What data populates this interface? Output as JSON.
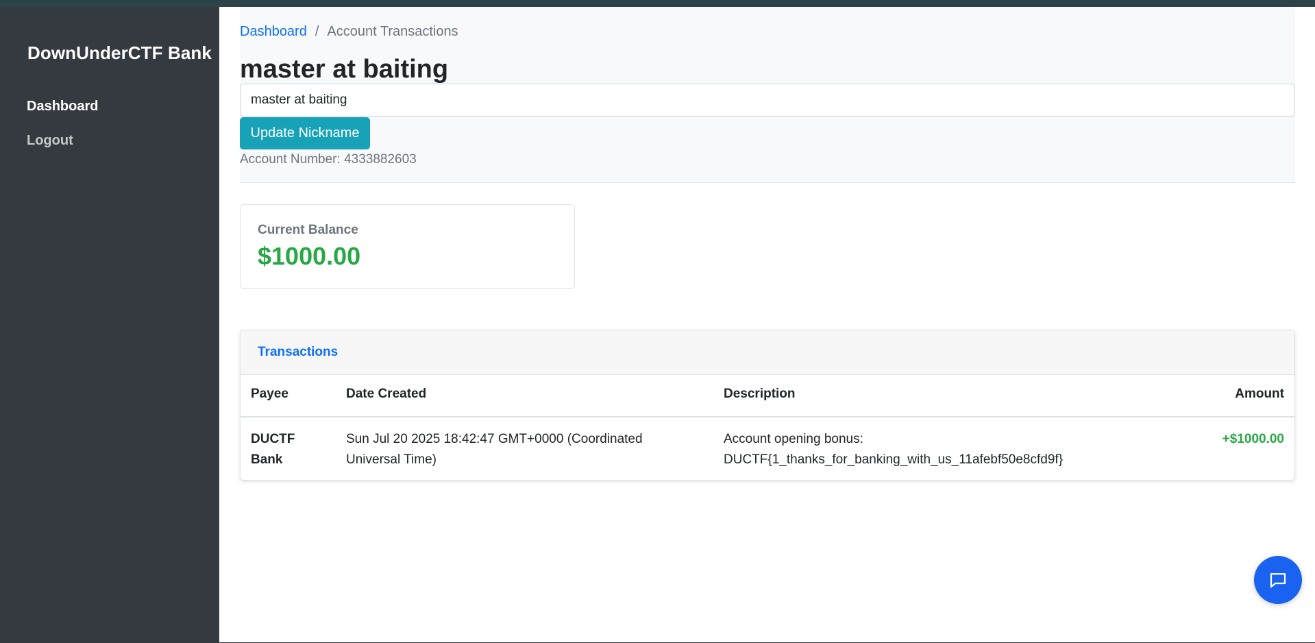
{
  "sidebar": {
    "brand": "DownUnderCTF Bank",
    "nav": [
      {
        "label": "Dashboard"
      },
      {
        "label": "Logout"
      }
    ]
  },
  "breadcrumb": {
    "home": "Dashboard",
    "separator": "/",
    "current": "Account Transactions"
  },
  "account": {
    "nickname_title": "master at baiting",
    "nickname_value": "master at baiting",
    "update_button": "Update Nickname",
    "account_number_text": "Account Number: 4333882603"
  },
  "balance": {
    "label": "Current Balance",
    "value": "$1000.00"
  },
  "transactions": {
    "title": "Transactions",
    "columns": [
      "Payee",
      "Date Created",
      "Description",
      "Amount"
    ],
    "rows": [
      {
        "payee": "DUCTF Bank",
        "date": "Sun Jul 20 2025 18:42:47 GMT+0000 (Coordinated Universal Time)",
        "description": "Account opening bonus: DUCTF{1_thanks_for_banking_with_us_11afebf50e8cfd9f}",
        "amount": "+$1000.00"
      }
    ]
  },
  "colors": {
    "sidebar_bg": "#343a40",
    "accent_teal": "#17a2b8",
    "link_blue": "#0d6efd",
    "positive_green": "#28a745",
    "chat_blue": "#1a63f0"
  },
  "icons": {
    "chat": "chat-bubble-icon"
  }
}
